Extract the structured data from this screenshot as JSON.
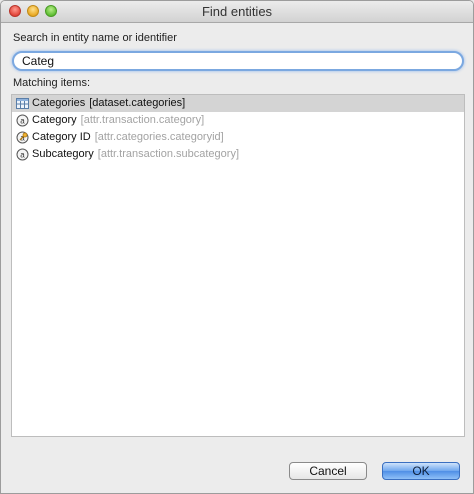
{
  "window": {
    "title": "Find entities"
  },
  "search": {
    "label": "Search in entity name or identifier",
    "value": "Categ"
  },
  "results": {
    "label": "Matching items:",
    "items": [
      {
        "name": "Categories",
        "identifier": "[dataset.categories]",
        "icon": "dataset-table-icon",
        "selected": true
      },
      {
        "name": "Category",
        "identifier": "[attr.transaction.category]",
        "icon": "attribute-icon",
        "selected": false
      },
      {
        "name": "Category ID",
        "identifier": "[attr.categories.categoryid]",
        "icon": "key-attribute-icon",
        "selected": false
      },
      {
        "name": "Subcategory",
        "identifier": "[attr.transaction.subcategory]",
        "icon": "attribute-icon",
        "selected": false
      }
    ]
  },
  "buttons": {
    "cancel": "Cancel",
    "ok": "OK"
  },
  "colors": {
    "accent": "#4f8fe6",
    "selection": "#d4d4d4",
    "identifier_text": "#a3a3a3"
  }
}
